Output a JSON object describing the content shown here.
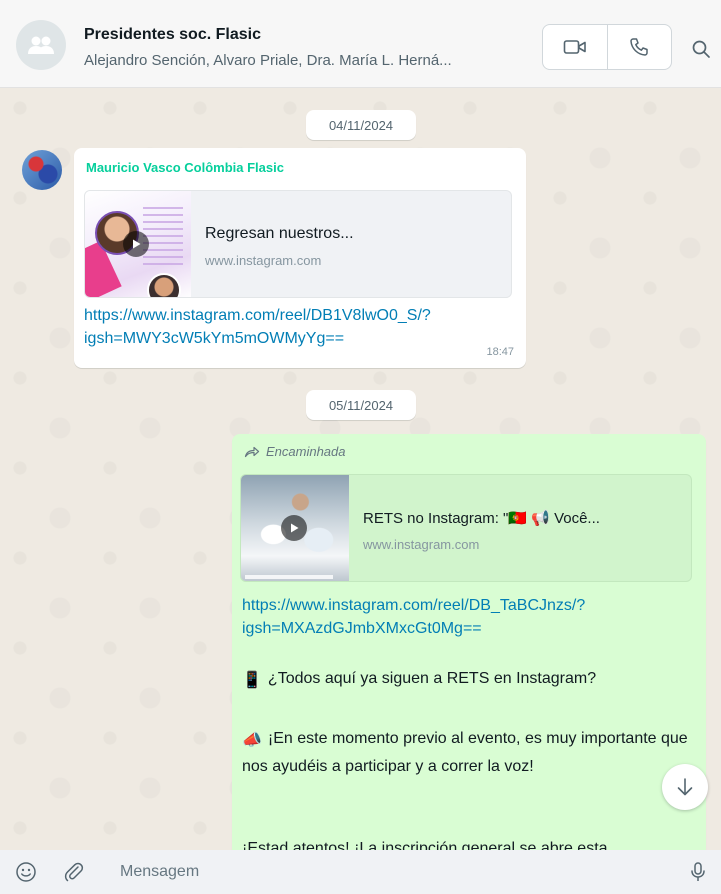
{
  "header": {
    "title": "Presidentes soc. Flasic",
    "members": "Alejandro Sención, Alvaro Priale, Dra. María L. Herná..."
  },
  "messages": {
    "date1": "04/11/2024",
    "incoming": {
      "sender": "Mauricio Vasco Colômbia Flasic",
      "preview_title": "Regresan nuestros...",
      "preview_domain": "www.instagram.com",
      "link_line1": "https://www.instagram.com/reel/DB1V8lwO0_S/?",
      "link_line2": "igsh=MWY3cW5kYm5mOWMyYg==",
      "time": "18:47"
    },
    "date2": "05/11/2024",
    "outgoing": {
      "forwarded_label": "Encaminhada",
      "preview_title": "RETS no Instagram: \"🇵🇹 📢 Você...",
      "preview_domain": "www.instagram.com",
      "link_line1": "https://www.instagram.com/reel/DB_TaBCJnzs/?",
      "link_line2": "igsh=MXAzdGJmbXMxcGt0Mg==",
      "para1_emoji": "📱",
      "para1": "¿Todos aquí ya siguen a RETS en Instagram?",
      "para2_emoji": "📣",
      "para2": "¡En este momento previo al evento, es muy importante que nos ayudéis a participar y a correr la voz!",
      "para3": "¡Estad atentos! ¡La inscripción general se abre esta"
    }
  },
  "composer": {
    "placeholder": "Mensagem"
  },
  "colors": {
    "sender_name": "#06cf9c",
    "link": "#027eb5",
    "outgoing_bubble": "#d9fdd3"
  }
}
